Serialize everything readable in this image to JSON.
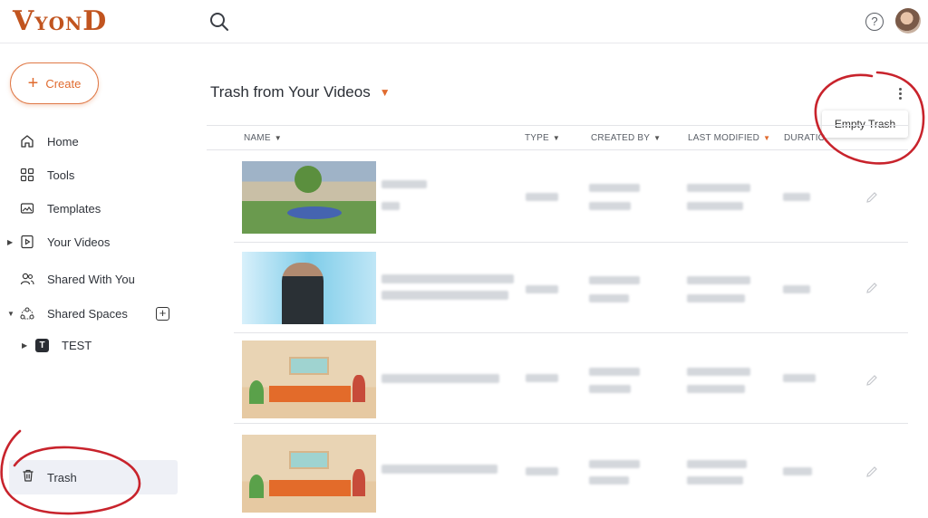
{
  "app": {
    "logo_text_1": "V",
    "logo_text_2": "Y",
    "logo_text_3": "O",
    "logo_text_4": "N",
    "logo_text_5": "D"
  },
  "header": {
    "search_icon": "search-icon",
    "help_icon": "help-icon",
    "help_glyph": "?"
  },
  "sidebar": {
    "create_label": "Create",
    "items": [
      {
        "label": "Home",
        "icon": "home-icon"
      },
      {
        "label": "Tools",
        "icon": "grid-icon"
      },
      {
        "label": "Templates",
        "icon": "templates-icon"
      },
      {
        "label": "Your Videos",
        "icon": "video-icon"
      },
      {
        "label": "Shared With You",
        "icon": "users-icon"
      },
      {
        "label": "Shared Spaces",
        "icon": "spaces-icon"
      }
    ],
    "space": {
      "badge": "T",
      "label": "TEST"
    },
    "trash_label": "Trash"
  },
  "main": {
    "title": "Trash from Your Videos",
    "menu_item": "Empty Trash",
    "columns": {
      "name": "NAME",
      "type": "TYPE",
      "created_by": "CREATED BY",
      "last_modified": "LAST MODIFIED",
      "duration": "DURATIO"
    }
  },
  "colors": {
    "accent": "#e06b2f",
    "logo": "#c1541f",
    "annotation": "#c8232c",
    "selected_bg": "#eef0f6"
  }
}
